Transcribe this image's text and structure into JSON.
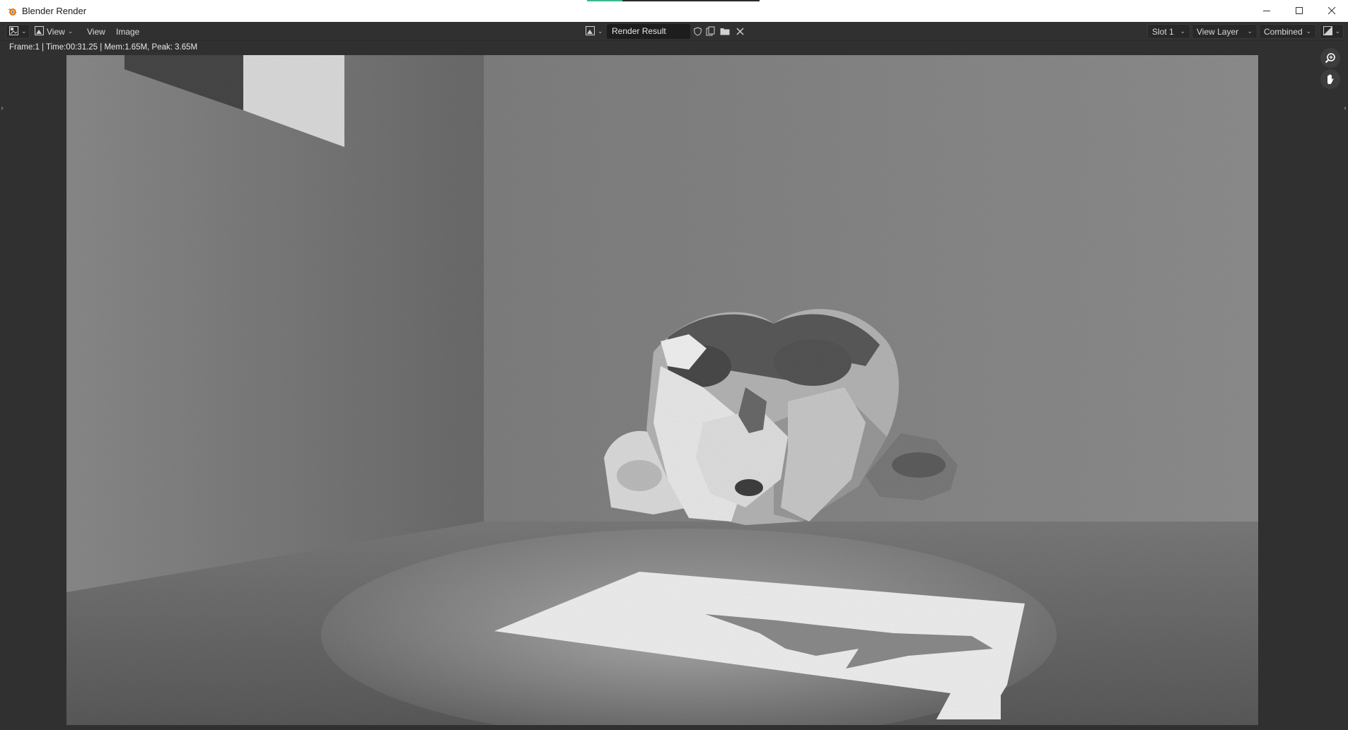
{
  "window": {
    "title": "Blender Render",
    "controls": [
      "minimize",
      "maximize",
      "close"
    ]
  },
  "header": {
    "menus": [
      {
        "label": "View",
        "has_caret": true
      },
      {
        "label": "View",
        "has_caret": false
      },
      {
        "label": "Image",
        "has_caret": false
      }
    ],
    "image_name": "Render Result",
    "slot": "Slot 1",
    "view_layer": "View Layer",
    "pass": "Combined"
  },
  "info": {
    "text": "Frame:1 | Time:00:31.25 | Mem:1.65M, Peak: 3.65M"
  },
  "colors": {
    "ui_bg": "#303030",
    "field_bg": "#1d1d1d",
    "title_bg": "#ffffff"
  },
  "icons": {
    "app": "blender-logo-icon",
    "editor_type": "image-editor-icon",
    "zoom": "zoom-icon",
    "pan": "hand-icon"
  }
}
